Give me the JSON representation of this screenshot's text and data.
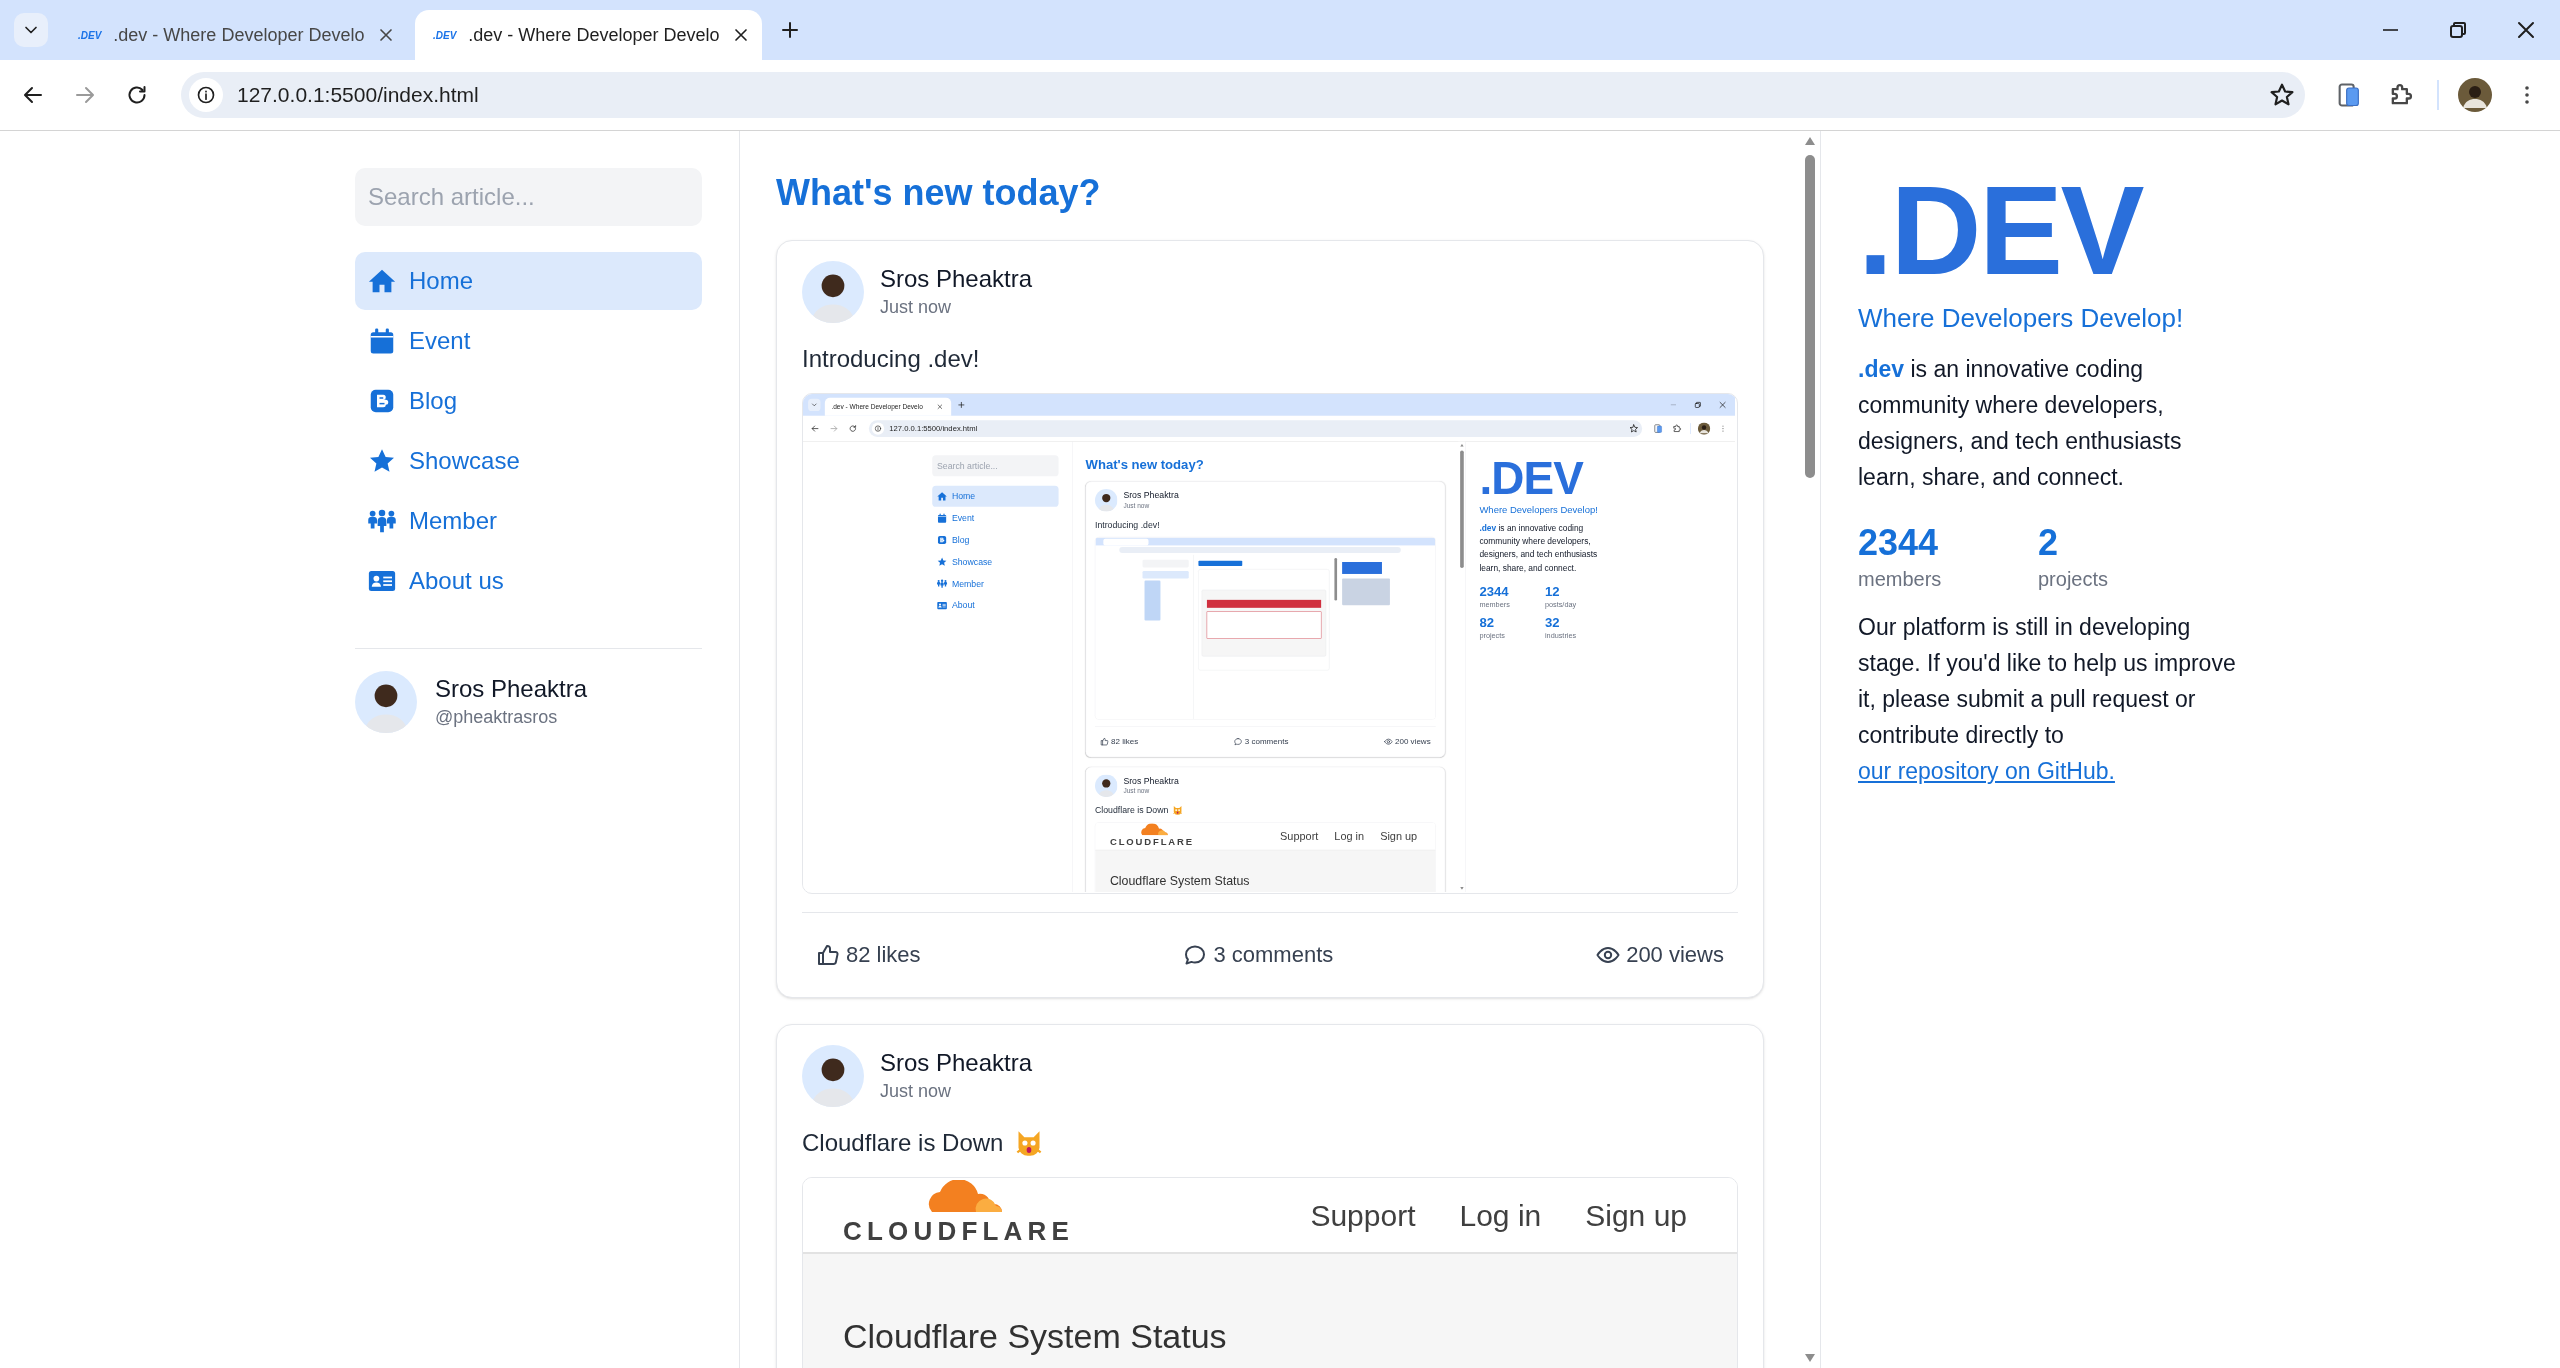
{
  "browser": {
    "tabs": [
      {
        "favicon": ".DEV",
        "title": ".dev - Where Developer Develo",
        "selected": false
      },
      {
        "favicon": ".DEV",
        "title": ".dev - Where Developer Develo",
        "selected": true
      }
    ],
    "address": "127.0.0.1:5500/index.html"
  },
  "page": {
    "search": {
      "placeholder": "Search article..."
    },
    "nav": [
      {
        "label": "Home",
        "selected": true
      },
      {
        "label": "Event",
        "selected": false
      },
      {
        "label": "Blog",
        "selected": false
      },
      {
        "label": "Showcase",
        "selected": false
      },
      {
        "label": "Member",
        "selected": false
      },
      {
        "label": "About us",
        "selected": false
      }
    ],
    "profile": {
      "name": "Sros Pheaktra",
      "handle": "@pheaktrasros"
    },
    "heading": "What's new today?",
    "posts": [
      {
        "author": "Sros Pheaktra",
        "time": "Just now",
        "text": "Introducing .dev!",
        "image": {
          "kind": "screenshot",
          "window": {
            "browser": {
              "tabs": [
                {
                  "title": ".dev - Where Developer Develo",
                  "selected": true
                }
              ],
              "address": "127.0.0.1:5500/index.html"
            },
            "page": {
              "search": {
                "placeholder": "Search article..."
              },
              "nav": [
                {
                  "label": "Home",
                  "selected": true
                },
                {
                  "label": "Event",
                  "selected": false
                },
                {
                  "label": "Blog",
                  "selected": false
                },
                {
                  "label": "Showcase",
                  "selected": false
                },
                {
                  "label": "Member",
                  "selected": false
                },
                {
                  "label": "About",
                  "selected": false
                }
              ],
              "heading": "What's new today?",
              "posts": [
                {
                  "author": "Sros Pheaktra",
                  "time": "Just now",
                  "text": "Introducing .dev!",
                  "image": {
                    "kind": "screenshot-drawing"
                  },
                  "footer": {
                    "likes": "82 likes",
                    "comments": "3 comments",
                    "views": "200 views"
                  }
                },
                {
                  "author": "Sros Pheaktra",
                  "time": "Just now",
                  "text": "Cloudflare is Down",
                  "emoji_icon": true,
                  "image": {
                    "kind": "cloudflare",
                    "logo": "CLOUDFLARE",
                    "links": [
                      "Support",
                      "Log in",
                      "Sign up"
                    ],
                    "title": "Cloudflare System Status"
                  }
                }
              ],
              "brand": {
                "logo": ".DEV",
                "tagline": "Where Developers Develop!",
                "intro": "**.dev** is an innovative coding community where developers, designers, and tech enthusiasts learn, share, and connect."
              },
              "stats": [
                {
                  "value": "2344",
                  "label": "members"
                },
                {
                  "value": "12",
                  "label": "posts/day"
                },
                {
                  "value": "82",
                  "label": "projects"
                },
                {
                  "value": "32",
                  "label": "industries"
                }
              ]
            }
          }
        },
        "footer": {
          "likes": "82 likes",
          "comments": "3 comments",
          "views": "200 views"
        }
      },
      {
        "author": "Sros Pheaktra",
        "time": "Just now",
        "text": "Cloudflare is Down",
        "emoji_icon": true,
        "image": {
          "kind": "cloudflare",
          "logo": "CLOUDFLARE",
          "links": [
            "Support",
            "Log in",
            "Sign up"
          ],
          "title": "Cloudflare System Status"
        }
      }
    ],
    "brand": {
      "logo": ".DEV",
      "tagline": "Where Developers Develop!",
      "intro": "**.dev** is an innovative coding community where developers, designers, and tech enthusiasts learn, share, and connect."
    },
    "stats": [
      {
        "value": "2344",
        "label": "members"
      },
      {
        "value": "2",
        "label": "projects"
      }
    ],
    "note": {
      "text": "Our platform is still in developing stage. If you'd like to help us improve it, please submit a pull request or contribute directly to",
      "link": "our repository on GitHub."
    }
  }
}
